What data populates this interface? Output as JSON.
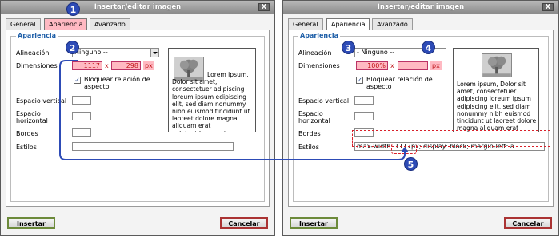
{
  "dialog_title": "Insertar/editar imagen",
  "close_symbol": "X",
  "tabs": {
    "general": "General",
    "appearance": "Apariencia",
    "advanced": "Avanzado"
  },
  "legend": "Apariencia",
  "labels": {
    "alignment": "Alineación",
    "dimensions": "Dimensiones",
    "keep_ratio": "Bloquear relación de aspecto",
    "vspace": "Espacio vertical",
    "hspace": "Espacio horizontal",
    "border": "Bordes",
    "styles": "Estilos"
  },
  "alignment_value": "Ninguno --",
  "alignment_value_right": "- Ninguno --",
  "left_dimensions": {
    "width": "1117",
    "height": "298",
    "sep": "x",
    "unit": "px"
  },
  "right_dimensions": {
    "width": "100%",
    "height": "",
    "sep": "x",
    "unit": "px"
  },
  "keep_ratio_checked": "✓",
  "preview_text": "Lorem ipsum, Dolor sit amet, consectetuer adipiscing loreum ipsum edipiscing elit, sed diam nonummy nibh euismod tincidunt ut laoreet dolore magna aliquam erat volutpat.Loreum ipsum",
  "styles_value": {
    "prefix": "max-width: ",
    "highlight": "1117",
    "suffix": "px; display: block; margin-left: a"
  },
  "buttons": {
    "insert": "Insertar",
    "cancel": "Cancelar"
  },
  "callouts": [
    "1",
    "2",
    "3",
    "4",
    "5"
  ],
  "colors": {
    "callout": "#2d4bb6",
    "highlight_pink": "#ffb9c2",
    "dashed_red": "#d9202a",
    "legend_blue": "#1f5fa8"
  },
  "icons": {
    "close": "close-icon",
    "dropdown": "chevron-down-icon",
    "checkbox": "checkbox-checked-icon",
    "preview": "tree-image-icon"
  }
}
